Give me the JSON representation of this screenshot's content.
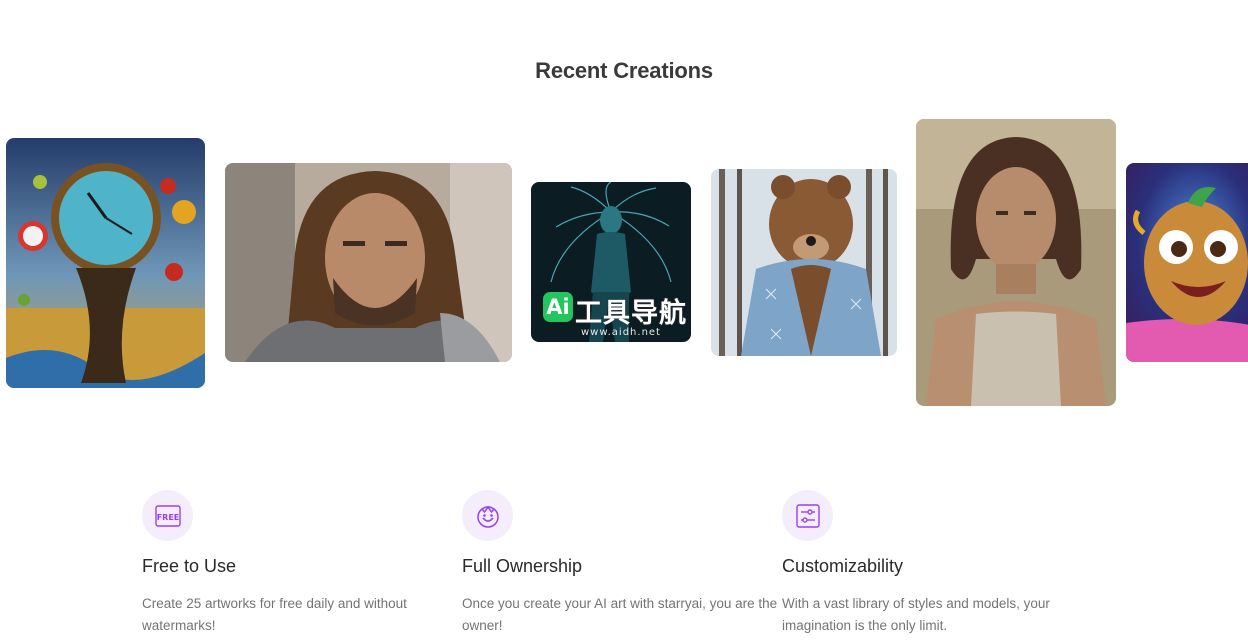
{
  "section": {
    "title": "Recent Creations"
  },
  "gallery": [
    {
      "name": "melting-clock-artwork"
    },
    {
      "name": "long-haired-warrior-portrait"
    },
    {
      "name": "ice-spirit-artwork"
    },
    {
      "name": "bear-in-jacket-artwork"
    },
    {
      "name": "woman-oil-portrait"
    },
    {
      "name": "cartoon-potato-artwork"
    }
  ],
  "watermark": {
    "badge": "Ai",
    "text": "工具导航",
    "url": "www.aidh.net"
  },
  "features": [
    {
      "icon": "free-icon",
      "icon_text": "FREE",
      "title": "Free to Use",
      "desc": "Create 25 artworks for free daily and without watermarks!"
    },
    {
      "icon": "smiley-crown-icon",
      "title": "Full Ownership",
      "desc": "Once you create your AI art with starryai, you are the owner!"
    },
    {
      "icon": "sliders-icon",
      "title": "Customizability",
      "desc": "With a vast library of styles and models, your imagination is the only limit."
    }
  ],
  "colors": {
    "accent": "#9b3ff2",
    "icon_bg": "#f4eefc"
  }
}
